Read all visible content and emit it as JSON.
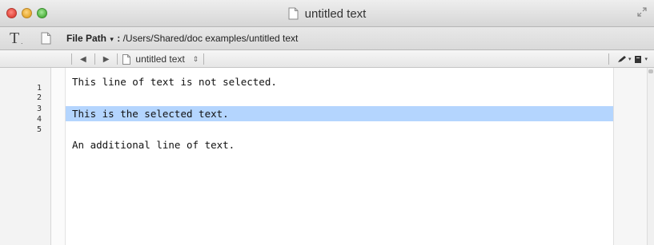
{
  "window": {
    "title": "untitled text",
    "icons": [
      "close-button",
      "minimize-button",
      "zoom-button",
      "document-icon",
      "fullscreen-icon"
    ]
  },
  "toolbar": {
    "text_tool_label": "T",
    "text_tool_sub": ".",
    "file_path_label": "File Path",
    "file_path_arrow": "▾",
    "file_path_separator": " : ",
    "file_path_value": "/Users/Shared/doc examples/untitled text"
  },
  "navbar": {
    "back": "◀",
    "forward": "▶",
    "document_name": "untitled text",
    "stepper": "⇕",
    "icons": [
      "pen-icon",
      "document-menu-icon"
    ]
  },
  "editor": {
    "line_numbers": [
      "1",
      "2",
      "3",
      "4",
      "5"
    ],
    "lines": [
      {
        "text": "This line of text is not selected.",
        "selected": false
      },
      {
        "text": "",
        "selected": false
      },
      {
        "text": "This is the selected text.",
        "selected": true
      },
      {
        "text": "",
        "selected": false
      },
      {
        "text": "An additional line of text.",
        "selected": false
      }
    ],
    "selection_color": "#b4d5fe"
  }
}
